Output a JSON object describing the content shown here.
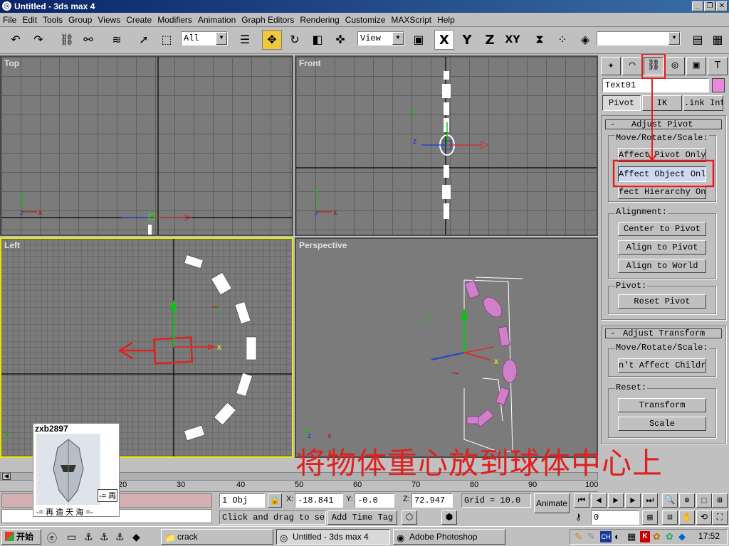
{
  "window": {
    "title": "Untitled - 3ds max 4"
  },
  "menu": [
    "File",
    "Edit",
    "Tools",
    "Group",
    "Views",
    "Create",
    "Modifiers",
    "Animation",
    "Graph Editors",
    "Rendering",
    "Customize",
    "MAXScript",
    "Help"
  ],
  "toolbar": {
    "selection_filter": "All",
    "ref_coord": "View",
    "axes": [
      "X",
      "Y",
      "Z",
      "XY"
    ]
  },
  "viewports": {
    "top": "Top",
    "front": "Front",
    "left": "Left",
    "perspective": "Perspective"
  },
  "command_panel": {
    "object_name": "Text01",
    "tabs": [
      "Pivot",
      "IK",
      ".ink Inf"
    ],
    "adjust_pivot": {
      "title": "Adjust Pivot",
      "collapse": "-",
      "move_group": "Move/Rotate/Scale:",
      "buttons": [
        "Affect Pivot Only",
        "Affect Object Only",
        "fect Hierarchy On"
      ],
      "alignment_group": "Alignment:",
      "align_buttons": [
        "Center to Pivot",
        "Align to Pivot",
        "Align to World"
      ],
      "pivot_group": "Pivot:",
      "reset_pivot": "Reset Pivot"
    },
    "adjust_transform": {
      "title": "Adjust Transform",
      "collapse": "-",
      "move_group": "Move/Rotate/Scale:",
      "button": "n't Affect Childr",
      "reset_group": "Reset:",
      "reset_buttons": [
        "Transform",
        "Scale"
      ]
    }
  },
  "timeline": {
    "ticks": [
      "20",
      "30",
      "40",
      "50",
      "60",
      "70",
      "80",
      "90",
      "100"
    ],
    "frame": "0"
  },
  "status": {
    "selection": "1 Obj",
    "x_label": "X:",
    "x": "-18.841",
    "y_label": "Y:",
    "y": "-0.0",
    "z_label": "Z:",
    "z": "72.947",
    "grid": "Grid = 10.0",
    "prompt": "Click and drag to sel",
    "add_time_tag": "Add Time Tag",
    "animate": "Animate",
    "current_frame": "0"
  },
  "overlay": {
    "caption": "将物体重心放到球体中心上",
    "avatar_name": "zxb2897",
    "avatar_caption": "-= 再 造 天 海 =-",
    "avatar_tag": "-= 再"
  },
  "taskbar": {
    "start": "开始",
    "items": [
      "crack",
      "Untitled - 3ds max 4",
      "Adobe Photoshop"
    ],
    "clock": "17:52"
  },
  "colors": {
    "highlight": "#e02020",
    "viewport_bg": "#7b7b7b",
    "active_border": "#e8e800",
    "object_pink": "#d080c8"
  }
}
